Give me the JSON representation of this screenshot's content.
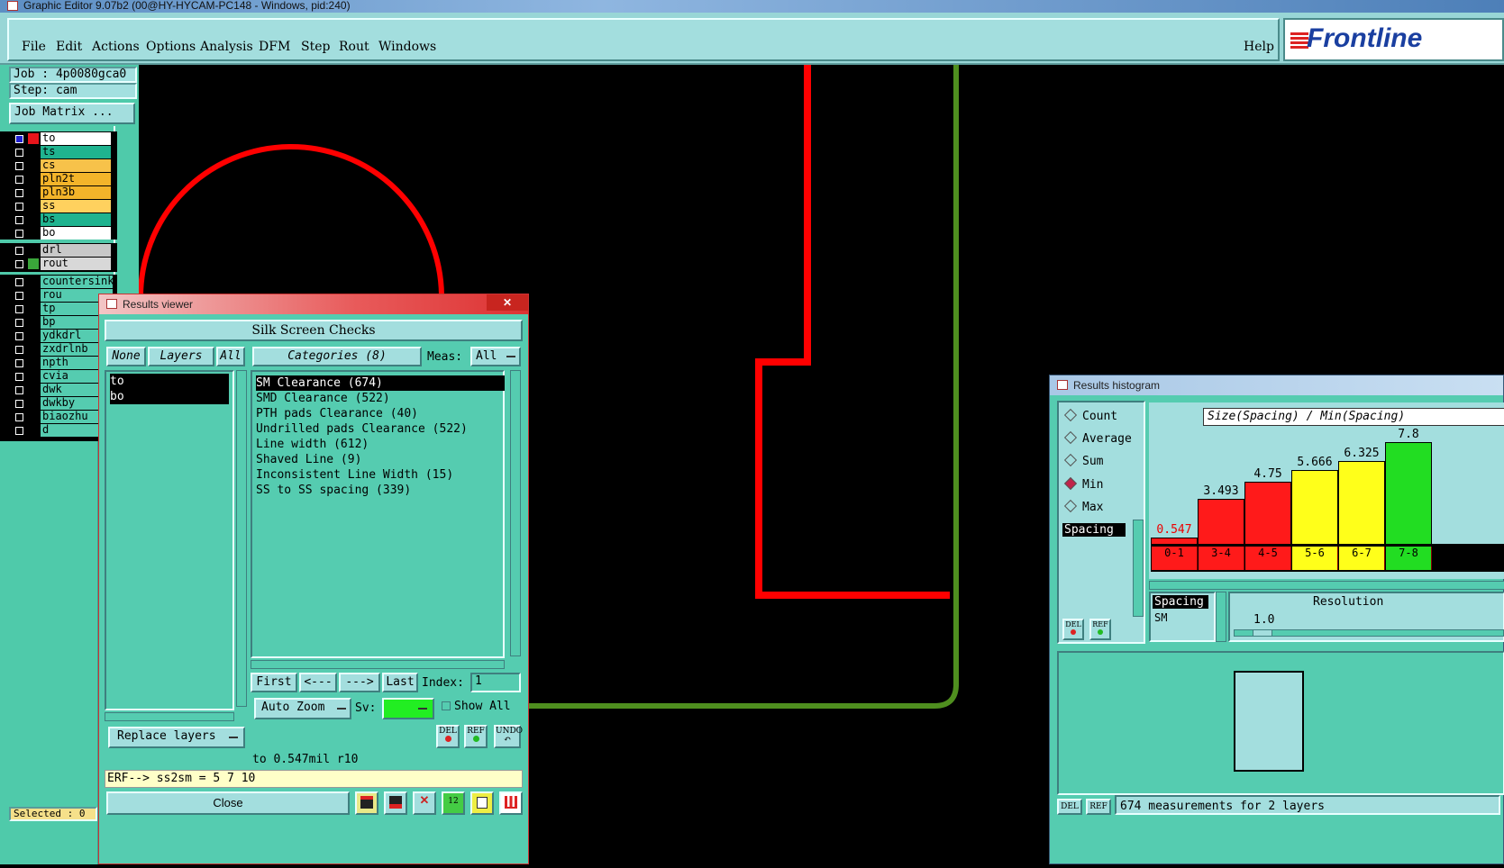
{
  "window_title": "Graphic Editor 9.07b2 (00@HY-HYCAM-PC148 - Windows, pid:240)",
  "menu": [
    "File",
    "Edit",
    "Actions",
    "Options",
    "Analysis",
    "DFM",
    "Step",
    "Rout",
    "Windows"
  ],
  "help_label": "Help",
  "logo_text": "Frontline",
  "job": {
    "job_label": "Job : 4p0080gca0",
    "step_label": "Step: cam",
    "matrix_button": "Job Matrix ..."
  },
  "layers": [
    {
      "name": "to",
      "color": "#ffffff",
      "swatch": "#e8151b",
      "active": true
    },
    {
      "name": "ts",
      "color": "#1fb38f",
      "swatch": ""
    },
    {
      "name": "cs",
      "color": "#f7c24a",
      "swatch": ""
    },
    {
      "name": "pln2t",
      "color": "#f3b42a",
      "swatch": ""
    },
    {
      "name": "pln3b",
      "color": "#f3b42a",
      "swatch": ""
    },
    {
      "name": "ss",
      "color": "#ffd15e",
      "swatch": ""
    },
    {
      "name": "bs",
      "color": "#1fb38f",
      "swatch": ""
    },
    {
      "name": "bo",
      "color": "#ffffff",
      "swatch": ""
    }
  ],
  "layers2": [
    {
      "name": "drl",
      "color": "#c8c8c8",
      "swatch": ""
    },
    {
      "name": "rout",
      "color": "#d8d8d8",
      "swatch": "#3aa63a"
    }
  ],
  "layers3": [
    "countersink",
    "rou",
    "tp",
    "bp",
    "ydkdrl",
    "zxdrlnb",
    "npth",
    "cvia",
    "dwk",
    "dwkby",
    "biaozhu",
    "d"
  ],
  "selected_label": "Selected : 0",
  "results_viewer": {
    "title": "Results viewer",
    "header": "Silk Screen Checks",
    "none_btn": "None",
    "layers_btn": "Layers",
    "all_btn": "All",
    "categories_btn": "Categories (8)",
    "meas_label": "Meas:",
    "meas_value": "All",
    "layer_list": [
      "to",
      "bo"
    ],
    "categories": [
      "SM Clearance (674)",
      "SMD Clearance (522)",
      "PTH pads Clearance (40)",
      "Undrilled pads Clearance (522)",
      "Line width (612)",
      "Shaved Line (9)",
      "Inconsistent Line Width (15)",
      "SS to SS spacing (339)"
    ],
    "first_btn": "First",
    "prev_btn": "<---",
    "next_btn": "--->",
    "last_btn": "Last",
    "index_label": "Index:",
    "index_value": "1",
    "auto_zoom": "Auto Zoom",
    "sv_label": "Sv:",
    "show_all": "Show All",
    "replace_layers": "Replace layers",
    "del_label": "DEL",
    "ref_label": "REF",
    "undo_label": "UNDO",
    "status_line": "to 0.547mil  r10",
    "erf_line": "ERF--> ss2sm = 5 7 10",
    "close_btn": "Close"
  },
  "histogram": {
    "title": "Results histogram",
    "modes": [
      "Count",
      "Average",
      "Sum",
      "Min",
      "Max"
    ],
    "selected_mode": "Min",
    "header": "Size(Spacing) / Min(Spacing)",
    "list_item": "Spacing",
    "list2_item": "Spacing",
    "list2_sub": "SM",
    "resolution_label": "Resolution",
    "resolution_value": "1.0",
    "footer": "674 measurements for 2 layers"
  },
  "chart_data": {
    "type": "bar",
    "categories": [
      "0-1",
      "3-4",
      "4-5",
      "5-6",
      "6-7",
      "7-8"
    ],
    "values": [
      0.547,
      3.493,
      4.75,
      5.666,
      6.325,
      7.8
    ],
    "value_labels": [
      "0.547",
      "3.493",
      "4.75",
      "5.666",
      "6.325",
      "7.8"
    ],
    "colors": [
      "#ff1a1a",
      "#ff1a1a",
      "#ff1a1a",
      "#ffff1a",
      "#ffff1a",
      "#22dd22"
    ],
    "title": "Size(Spacing) / Min(Spacing)"
  }
}
